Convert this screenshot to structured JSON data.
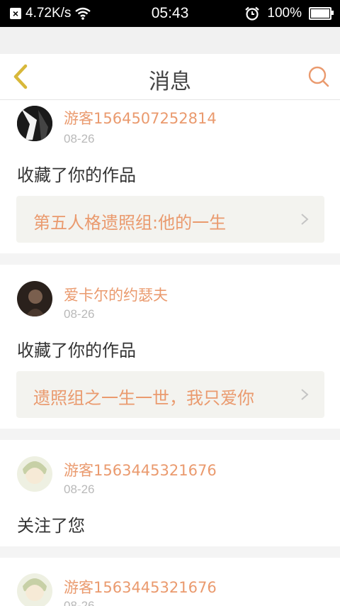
{
  "status_bar": {
    "network_speed": "4.72K/s",
    "time": "05:43",
    "battery": "100%",
    "icons": [
      "notification-x-icon",
      "wifi-icon",
      "alarm-icon",
      "battery-icon"
    ]
  },
  "header": {
    "title": "消息",
    "back_icon": "chevron-left-icon",
    "search_icon": "search-icon"
  },
  "colors": {
    "accent": "#ea9a6e",
    "back_icon": "#d8b83a",
    "card_bg": "#ffffff",
    "page_bg": "#f4f4f4",
    "work_box_bg": "#f3f3ef"
  },
  "messages": [
    {
      "username": "游客1564507252814",
      "date": "08-26",
      "action": "收藏了你的作品",
      "work_title": "第五人格遗照组:他的一生"
    },
    {
      "username": "爱卡尔的约瑟夫",
      "date": "08-26",
      "action": "收藏了你的作品",
      "work_title": "遗照组之一生一世，我只爱你"
    },
    {
      "username": "游客1563445321676",
      "date": "08-26",
      "action": "关注了您"
    },
    {
      "username": "游客1563445321676",
      "date": "08-26"
    }
  ]
}
